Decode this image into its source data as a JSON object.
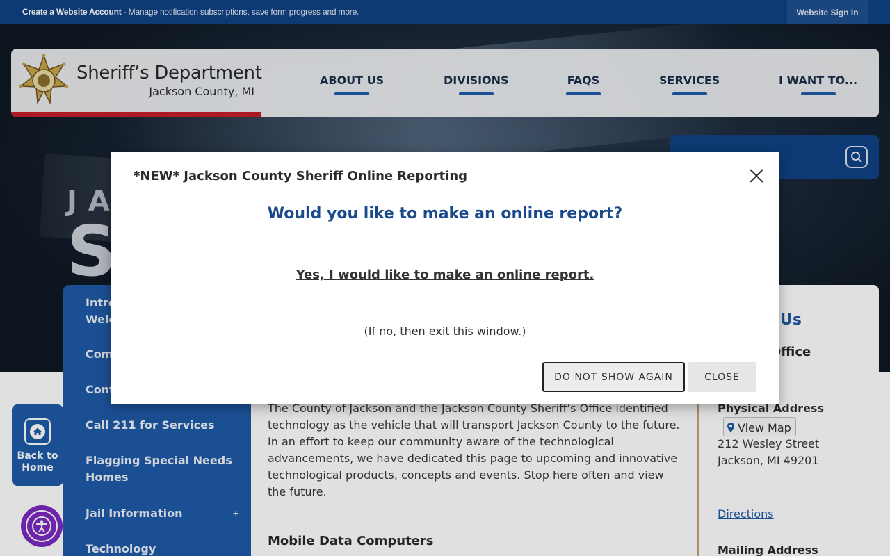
{
  "topbar": {
    "create_account_bold": "Create a Website Account",
    "create_account_rest": " - Manage notification subscriptions, save form progress and more.",
    "sign_in": "Website Sign In"
  },
  "header": {
    "title": "Sheriff’s Department",
    "subtitle": "Jackson County, MI",
    "badge_icon": "sheriff-star-badge-icon",
    "nav": [
      {
        "label": "ABOUT US"
      },
      {
        "label": "DIVISIONS"
      },
      {
        "label": "FAQS"
      },
      {
        "label": "SERVICES"
      },
      {
        "label": "I WANT TO..."
      }
    ]
  },
  "hero": {
    "text_fragment_1": "JA",
    "text_fragment_2": "S"
  },
  "search": {
    "icon": "search-icon"
  },
  "sidebar": {
    "items": [
      {
        "label": "Introd\nWelco"
      },
      {
        "label": "Comm"
      },
      {
        "label": "Conta"
      },
      {
        "label": "Call 211 for Services"
      },
      {
        "label": "Flagging Special Needs\nHomes"
      },
      {
        "label": "Jail Information"
      },
      {
        "label": "Technology"
      }
    ],
    "expand_symbol": "+"
  },
  "main": {
    "paragraph": "The County of Jackson and the Jackson County Sheriff’s Office identified technology as the vehicle that will transport Jackson County to the future. In an effort to keep our community aware of the technological advancements, we have dedicated this page to upcoming and innovative technological products, concepts and events. Stop here often and view the future.",
    "section_heading": "Mobile Data Computers"
  },
  "contact": {
    "title": "Us",
    "office": "Office",
    "physical_label": "Physical Address",
    "view_map": "View Map",
    "address_line1": "212 Wesley Street",
    "address_line2": "Jackson, MI 49201",
    "directions": "Directions",
    "mailing_label": "Mailing Address"
  },
  "back_home": {
    "label_line1": "Back to",
    "label_line2": "Home",
    "icon": "home-icon"
  },
  "accessibility": {
    "icon": "accessibility-icon"
  },
  "modal": {
    "title": "*NEW* Jackson County Sheriff Online Reporting",
    "question": "Would you like to make an online report?",
    "link": "Yes, I would like to make an online report.",
    "note": "(If no, then exit this window.)",
    "dont_show_again": "DO NOT SHOW AGAIN",
    "close": "CLOSE",
    "close_icon": "close-icon"
  }
}
